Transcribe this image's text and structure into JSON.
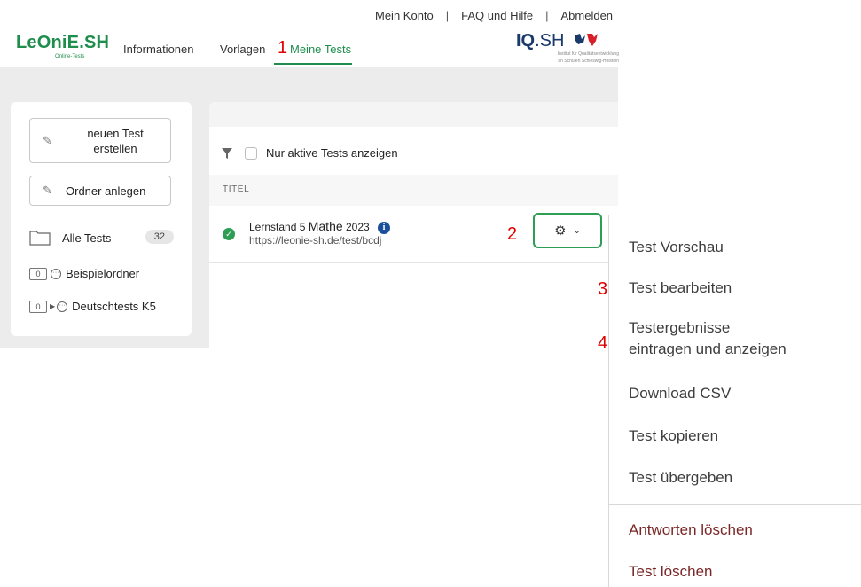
{
  "top_links": {
    "account": "Mein Konto",
    "faq": "FAQ und Hilfe",
    "logout": "Abmelden",
    "separator": "|"
  },
  "logo": {
    "name": "LeOniE.SH",
    "subtitle": "Online-Tests"
  },
  "nav": {
    "info": "Informationen",
    "templates": "Vorlagen",
    "my_tests": "Meine Tests"
  },
  "partner_logo": {
    "name_bold": "IQ",
    "name_light": ".SH",
    "tagline_1": "Institut für Qualitätsentwicklung",
    "tagline_2": "an Schulen Schleswig-Holstein"
  },
  "markers": {
    "m1": "1",
    "m2": "2",
    "m3": "3",
    "m4": "4"
  },
  "sidebar": {
    "new_test_line1": "neuen Test",
    "new_test_line2": "erstellen",
    "create_folder": "Ordner anlegen",
    "all_tests": "Alle Tests",
    "all_tests_count": "32",
    "folders": [
      {
        "count": "0",
        "name": "Beispielordner"
      },
      {
        "count": "0",
        "name": "Deutschtests K5"
      }
    ]
  },
  "list": {
    "filter_label": "Nur aktive Tests anzeigen",
    "column_title": "TITEL",
    "tests": [
      {
        "title_part1": "Lernstand 5",
        "title_part2": "Mathe",
        "title_part3": "2023",
        "url": "https://leonie-sh.de/test/bcdj"
      }
    ]
  },
  "dropdown": {
    "items": [
      "Test Vorschau",
      "Test bearbeiten",
      "Testergebnisse",
      "eintragen und anzeigen",
      "Download CSV",
      "Test kopieren",
      "Test übergeben",
      "Antworten löschen",
      "Test löschen"
    ]
  },
  "colors": {
    "brand_green": "#1f8e4d",
    "marker_red": "#e00000",
    "danger": "#7a2727",
    "info_blue": "#1b4f9c"
  },
  "icons": [
    "pencil-icon",
    "folder-icon",
    "filter-icon",
    "check-icon",
    "info-icon",
    "gear-icon",
    "chevron-down-icon"
  ]
}
